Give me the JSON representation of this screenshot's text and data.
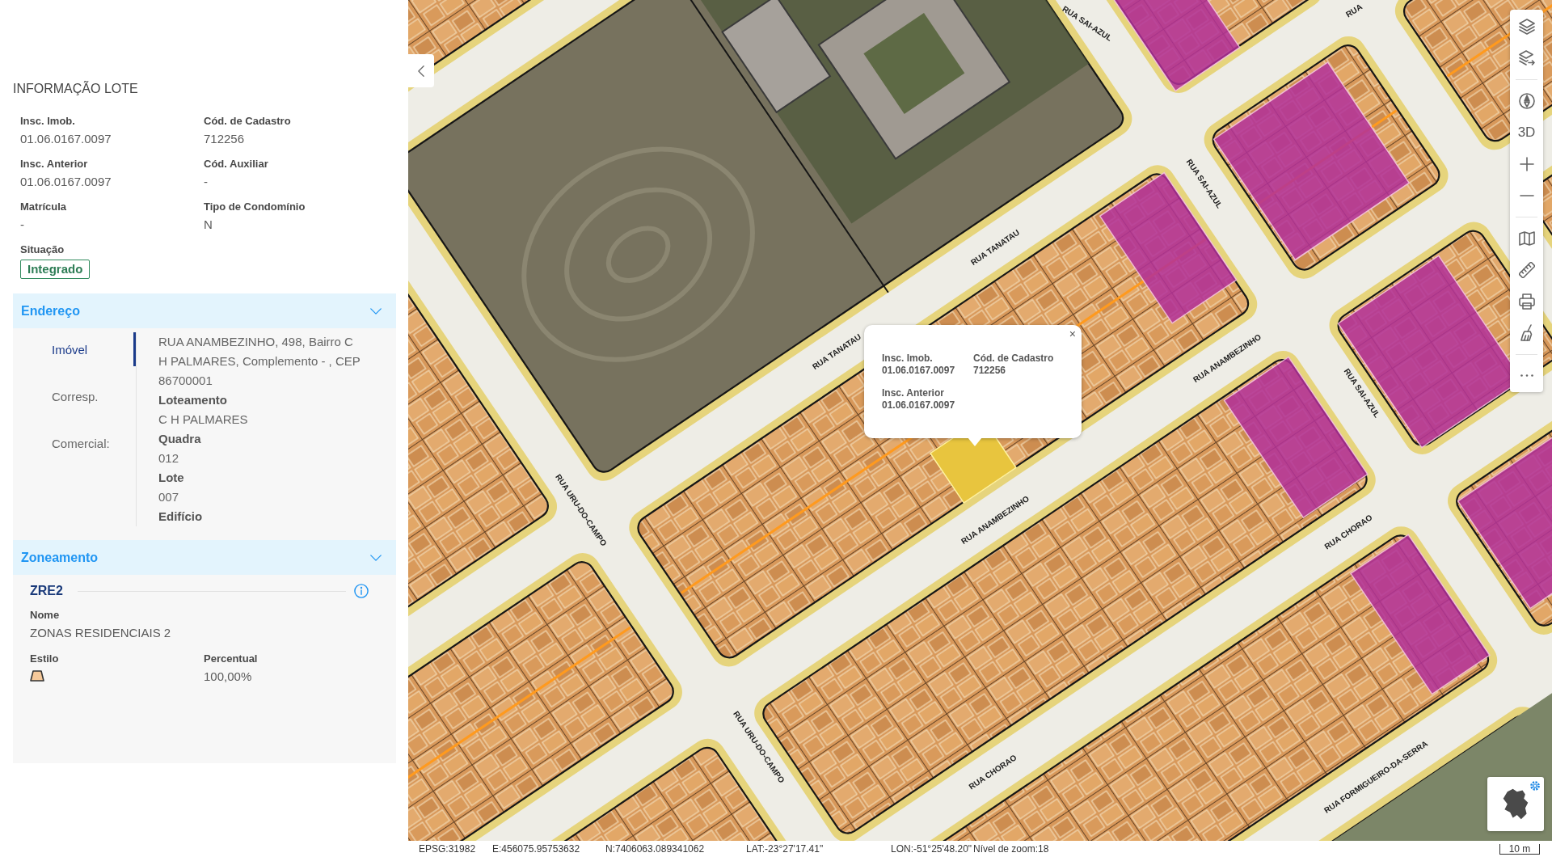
{
  "panel": {
    "title": "INFORMAÇÃO LOTE",
    "fields": [
      {
        "label": "Insc. Imob.",
        "value": "01.06.0167.0097"
      },
      {
        "label": "Cód. de Cadastro",
        "value": "712256"
      },
      {
        "label": "Insc. Anterior",
        "value": "01.06.0167.0097"
      },
      {
        "label": "Cód. Auxiliar",
        "value": "-"
      },
      {
        "label": "Matrícula",
        "value": "-"
      },
      {
        "label": "Tipo de Condomínio",
        "value": "N"
      }
    ],
    "status": {
      "label": "Situação",
      "value": "Integrado"
    }
  },
  "sections": [
    {
      "kind": "address",
      "title": "Endereço",
      "expanded": true,
      "tabs": [
        {
          "label": "Imóvel",
          "selected": true
        },
        {
          "label": "Corresp.",
          "selected": false
        },
        {
          "label": "Comercial:",
          "selected": false
        }
      ],
      "address": "RUA ANAMBEZINHO, 498, Bairro C H PALMARES, Complemento - , CEP 86700001",
      "details": [
        {
          "label": "Loteamento",
          "value": "C H PALMARES"
        },
        {
          "label": "Quadra",
          "value": "012"
        },
        {
          "label": "Lote",
          "value": "007"
        },
        {
          "label": "Edifício"
        }
      ]
    },
    {
      "kind": "zoning",
      "title": "Zoneamento",
      "expanded": true,
      "zone": {
        "code": "ZRE2",
        "name_label": "Nome",
        "name": "ZONAS RESIDENCIAIS 2",
        "style_label": "Estilo",
        "percent_label": "Percentual",
        "percent": "100,00%"
      }
    }
  ],
  "map": {
    "street_labels": [
      "RUA SAI-AZUL",
      "RUA",
      "RUA SAI-AZUL",
      "RUA TANATAU",
      "RUA ANAMBEZINHO",
      "RUA TANATAU",
      "RUA SAI-AZUL",
      "RUA URU-DO-CAMPO",
      "RUA ANAMBEZINHO",
      "RUA CHORAO",
      "RUA URU-DO-CAMPO",
      "RUA CHORAO",
      "RUA FORMIGUEIRO-DA-SERRA"
    ],
    "popup": {
      "close": "×",
      "fields": [
        {
          "label": "Insc. Imob.",
          "value": "01.06.0167.0097"
        },
        {
          "label": "Cód. de Cadastro",
          "value": "712256"
        },
        {
          "label": "Insc. Anterior",
          "value": "01.06.0167.0097"
        }
      ]
    },
    "toolbar": {
      "view_mode": "3D"
    }
  },
  "status_bar": {
    "epsg": "EPSG:31982",
    "easting": "E:456075.95753632",
    "northing": "N:7406063.089341062",
    "latitude": "LAT:-23°27'17.41\"",
    "longitude": "LON:-51°25'48.20\"",
    "zoom": "Nível de zoom:18",
    "scale": "10 m"
  }
}
